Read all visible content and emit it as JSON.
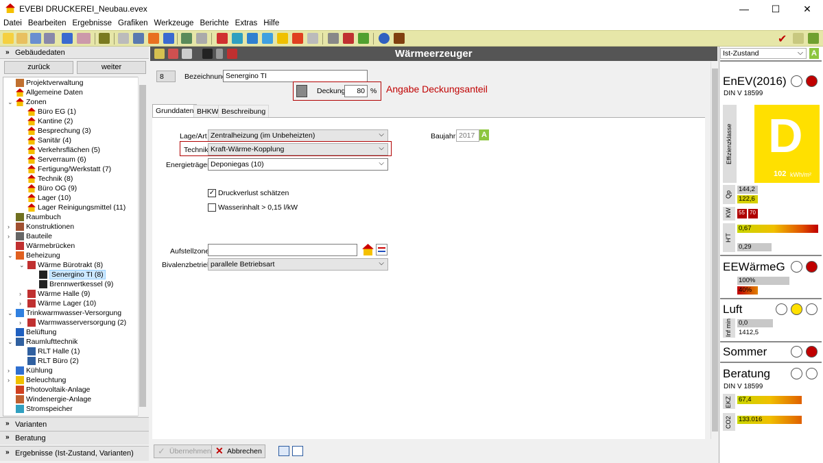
{
  "window": {
    "title": "EVEBI DRUCKEREI_Neubau.evex",
    "minimize": "—",
    "maximize": "☐",
    "close": "✕"
  },
  "menu": [
    "Datei",
    "Bearbeiten",
    "Ergebnisse",
    "Grafiken",
    "Werkzeuge",
    "Berichte",
    "Extras",
    "Hilfe"
  ],
  "left": {
    "header": "Gebäudedaten",
    "back": "zurück",
    "forward": "weiter",
    "tree": [
      {
        "label": "Projektverwaltung",
        "level": 0,
        "icon": "project-icon",
        "exp": ""
      },
      {
        "label": "Allgemeine Daten",
        "level": 0,
        "icon": "house-icon",
        "exp": ""
      },
      {
        "label": "Zonen",
        "level": 0,
        "icon": "house-icon",
        "exp": "v"
      },
      {
        "label": "Büro EG (1)",
        "level": 1,
        "icon": "house-icon",
        "exp": ""
      },
      {
        "label": "Kantine (2)",
        "level": 1,
        "icon": "house-icon",
        "exp": ""
      },
      {
        "label": "Besprechung (3)",
        "level": 1,
        "icon": "house-icon",
        "exp": ""
      },
      {
        "label": "Sanitär (4)",
        "level": 1,
        "icon": "house-icon",
        "exp": ""
      },
      {
        "label": "Verkehrsflächen (5)",
        "level": 1,
        "icon": "house-icon",
        "exp": ""
      },
      {
        "label": "Serverraum (6)",
        "level": 1,
        "icon": "house-icon",
        "exp": ""
      },
      {
        "label": "Fertigung/Werkstatt (7)",
        "level": 1,
        "icon": "house-icon",
        "exp": ""
      },
      {
        "label": "Technik (8)",
        "level": 1,
        "icon": "house-icon",
        "exp": ""
      },
      {
        "label": "Büro OG (9)",
        "level": 1,
        "icon": "house-icon",
        "exp": ""
      },
      {
        "label": "Lager (10)",
        "level": 1,
        "icon": "house-icon",
        "exp": ""
      },
      {
        "label": "Lager Reinigungsmittel (11)",
        "level": 1,
        "icon": "house-icon",
        "exp": ""
      },
      {
        "label": "Raumbuch",
        "level": 0,
        "icon": "book-icon",
        "exp": ""
      },
      {
        "label": "Konstruktionen",
        "level": 0,
        "icon": "wall-icon",
        "exp": ">"
      },
      {
        "label": "Bauteile",
        "level": 0,
        "icon": "building-icon",
        "exp": ">"
      },
      {
        "label": "Wärmebrücken",
        "level": 0,
        "icon": "bridge-icon",
        "exp": ""
      },
      {
        "label": "Beheizung",
        "level": 0,
        "icon": "fire-icon",
        "exp": "v"
      },
      {
        "label": "Wärme Bürotrakt (8)",
        "level": 1,
        "icon": "radiator-icon",
        "exp": "v"
      },
      {
        "label": "Senergino TI (8)",
        "level": 2,
        "icon": "boiler-icon",
        "exp": "",
        "selected": true
      },
      {
        "label": "Brennwertkessel (9)",
        "level": 2,
        "icon": "boiler-icon",
        "exp": ""
      },
      {
        "label": "Wärme Halle (9)",
        "level": 1,
        "icon": "radiator-icon",
        "exp": ">"
      },
      {
        "label": "Wärme Lager (10)",
        "level": 1,
        "icon": "radiator-icon",
        "exp": ">"
      },
      {
        "label": "Trinkwarmwasser-Versorgung",
        "level": 0,
        "icon": "water-drop-icon",
        "exp": "v"
      },
      {
        "label": "Warmwasserversorgung (2)",
        "level": 1,
        "icon": "radiator-icon",
        "exp": ">"
      },
      {
        "label": "Belüftung",
        "level": 0,
        "icon": "fan-icon",
        "exp": ""
      },
      {
        "label": "Raumlufttechnik",
        "level": 0,
        "icon": "ventilation-icon",
        "exp": "v"
      },
      {
        "label": "RLT Halle (1)",
        "level": 1,
        "icon": "ventilation-icon",
        "exp": ""
      },
      {
        "label": "RLT Büro (2)",
        "level": 1,
        "icon": "ventilation-icon",
        "exp": ""
      },
      {
        "label": "Kühlung",
        "level": 0,
        "icon": "snowflake-icon",
        "exp": ">"
      },
      {
        "label": "Beleuchtung",
        "level": 0,
        "icon": "bulb-icon",
        "exp": ">"
      },
      {
        "label": "Photovoltaik-Anlage",
        "level": 0,
        "icon": "solar-icon",
        "exp": ""
      },
      {
        "label": "Windenergie-Anlage",
        "level": 0,
        "icon": "wind-icon",
        "exp": ""
      },
      {
        "label": "Stromspeicher",
        "level": 0,
        "icon": "battery-icon",
        "exp": ""
      }
    ],
    "accordions": [
      "Varianten",
      "Beratung",
      "Ergebnisse (Ist-Zustand, Varianten)"
    ]
  },
  "main": {
    "title": "Wärmeerzeuger",
    "id": "8",
    "bezeichnung_label": "Bezeichnung",
    "bezeichnung": "Senergino TI",
    "deckung_label": "Deckung",
    "deckung": "80",
    "deckung_unit": "%",
    "annotation": "Angabe Deckungsanteil",
    "tabs": [
      "Grunddaten",
      "BHKW",
      "Beschreibung"
    ],
    "lage_label": "Lage/Art",
    "lage": "Zentralheizung (im Unbeheizten)",
    "technik_label": "Technik",
    "technik": "Kraft-Wärme-Kopplung",
    "energie_label": "Energieträger",
    "energie": "Deponiegas (10)",
    "baujahr_label": "Baujahr",
    "baujahr": "2017",
    "baujahr_badge": "A",
    "druck": "Druckverlust schätzen",
    "druck_checked": true,
    "wasser": "Wasserinhalt > 0,15 l/kW",
    "wasser_checked": false,
    "aufstell_label": "Aufstellzone",
    "aufstell": "",
    "bival_label": "Bivalenzbetrieb",
    "bival": "parallele Betriebsart",
    "ok": "Übernehmen",
    "cancel": "Abbrechen"
  },
  "right": {
    "state": "Ist-Zustand",
    "state_badge": "A",
    "enev": "EnEV(2016)",
    "din": "DIN V 18599",
    "effizienz_label": "Effizienzklasse",
    "klasse": "D",
    "klasse_value": "102",
    "klasse_unit": "kWh/m²",
    "qp_label": "Qp",
    "qp1": "144,2",
    "qp2": "122,6",
    "kw_label": "KW",
    "kw1": "55",
    "kw2": "70",
    "ht_label": "H'T",
    "ht1": "0,67",
    "ht2": "0,29",
    "ee": "EEWärmeG",
    "ee1": "100%",
    "ee2": "40%",
    "luft": "Luft",
    "inf_label": "Inf min",
    "luft1": "0,0",
    "luft2": "1412,5",
    "sommer": "Sommer",
    "beratung": "Beratung",
    "din2": "DIN V 18599",
    "ekz_label": "EKZ",
    "ekz": "67,4",
    "co2_label": "CO2",
    "co2": "133.016",
    "colors": {
      "yellow": "#ffe000",
      "red": "#c00000",
      "green": "#8dc63f"
    }
  }
}
